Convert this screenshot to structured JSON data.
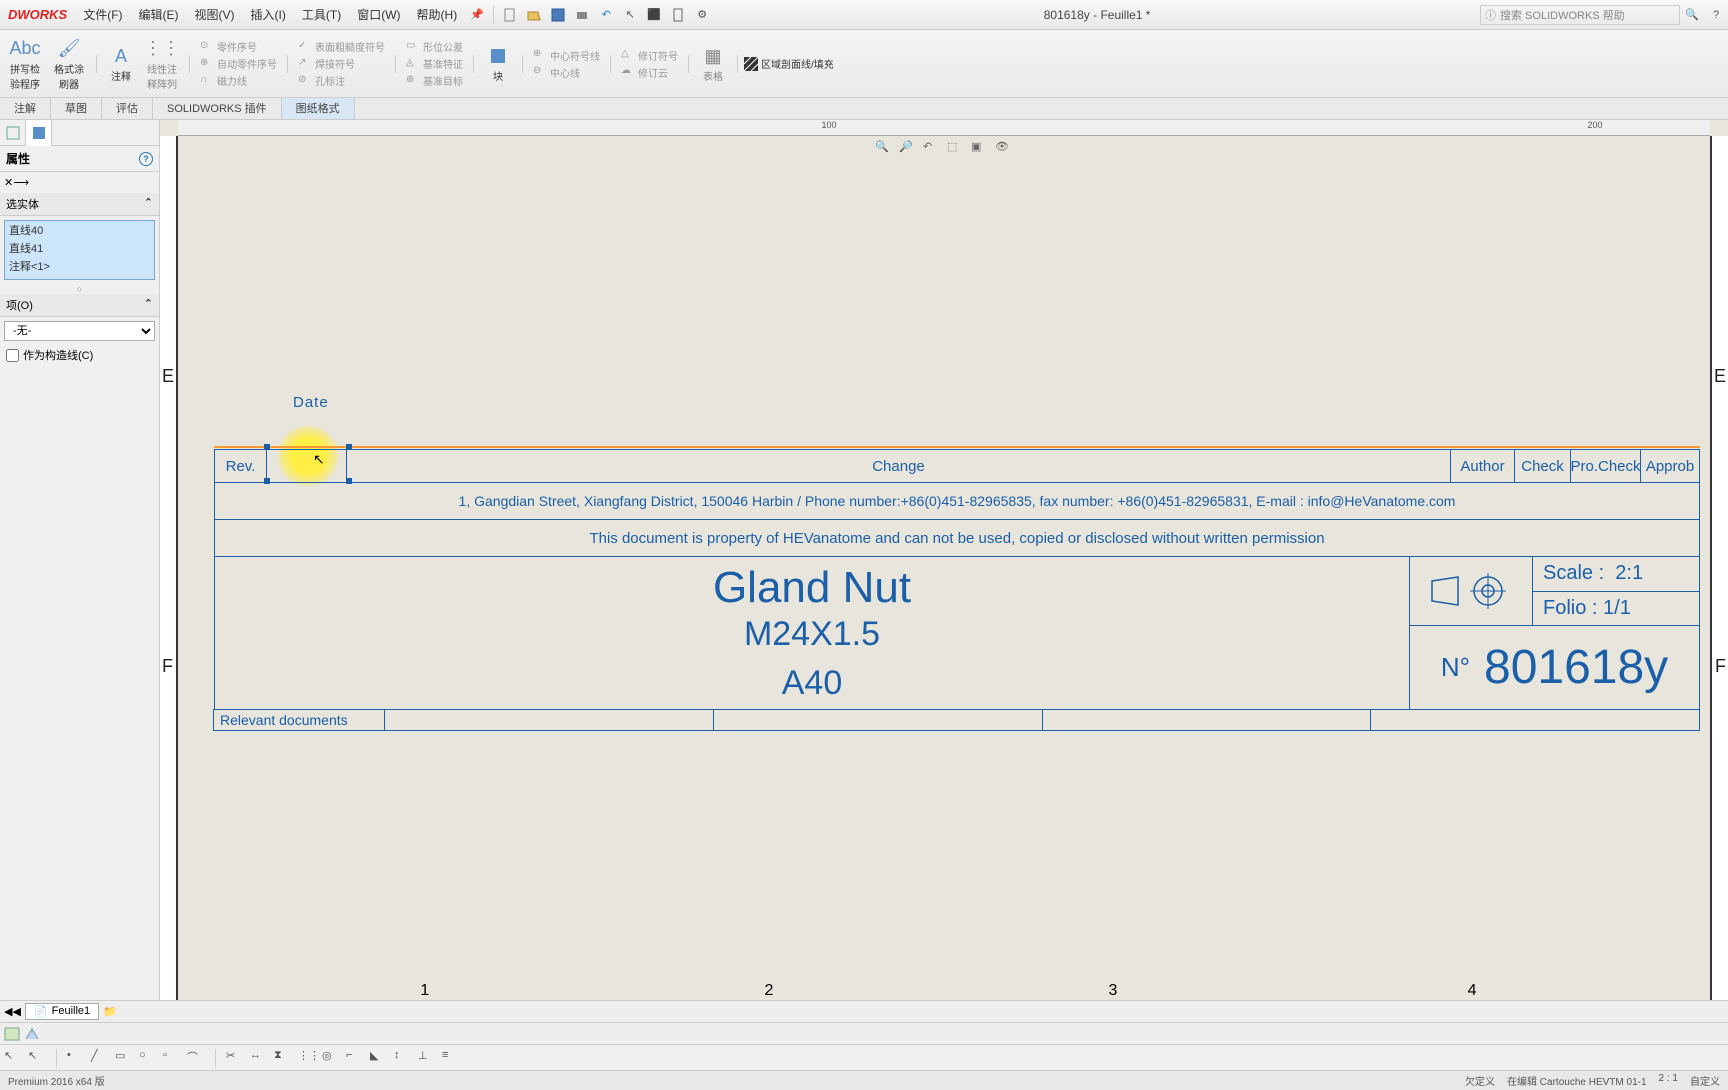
{
  "app": {
    "logo": "DWORKS",
    "doc": "801618y - Feuille1 *",
    "search_ph": "搜索 SOLIDWORKS 帮助"
  },
  "menu": [
    "文件(F)",
    "编辑(E)",
    "视图(V)",
    "插入(I)",
    "工具(T)",
    "窗口(W)",
    "帮助(H)"
  ],
  "ribbon": {
    "btns": [
      {
        "l1": "拼写检",
        "l2": "验程序"
      },
      {
        "l1": "格式涂",
        "l2": "刷器"
      },
      {
        "l1": "注释",
        "l2": ""
      },
      {
        "l1": "线性注",
        "l2": "释阵列"
      }
    ],
    "col1": [
      "零件序号",
      "自动零件序号",
      "磁力线"
    ],
    "col2": [
      "表面粗糙度符号",
      "焊接符号",
      "孔标注"
    ],
    "col3": [
      "形位公差",
      "基准特征",
      "基准目标"
    ],
    "blk": "块",
    "col4": [
      "中心符号线",
      "中心线",
      ""
    ],
    "col5": [
      "修订符号",
      "修订云",
      ""
    ],
    "tbl": "表格",
    "hatch": "区域剖面线/填充"
  },
  "tabs": [
    "注解",
    "草图",
    "评估",
    "SOLIDWORKS 插件",
    "图纸格式"
  ],
  "ruler_h": [
    "100",
    "200"
  ],
  "panel": {
    "title": "属性",
    "sec1": "选实体",
    "items": [
      "直线40",
      "直线41",
      "注释<1>"
    ],
    "sec2": "项(O)",
    "dd": "-无-",
    "chk": "作为构造线(C)"
  },
  "zones": {
    "e": "E",
    "f": "F"
  },
  "date_lbl": "Date",
  "tb": {
    "headers": [
      "Rev.",
      "",
      "Change",
      "Author",
      "Check",
      "Pro.Check",
      "Approb"
    ],
    "addr": "1, Gangdian Street, Xiangfang District, 150046 Harbin / Phone number:+86(0)451-82965835, fax number: +86(0)451-82965831, E-mail : info@HeVanatome.com",
    "prop": "This document is property of HEVanatome and can not be used, copied or disclosed without written permission",
    "part_name": "Gland Nut",
    "part_size": "M24X1.5",
    "part_mat": "A40",
    "scale_lbl": "Scale :",
    "scale_val": "2:1",
    "folio_lbl": "Folio :",
    "folio_val": "1/1",
    "num_lbl": "N°",
    "num_val": "801618y",
    "rel": "Relevant documents"
  },
  "bottom_marks": [
    "1",
    "2",
    "3",
    "4"
  ],
  "sheet": "Feuille1",
  "status": {
    "ver": "Premium 2016 x64 版",
    "r1": "欠定义",
    "r2": "在编辑 Cartouche HEVTM 01-1",
    "r3": "2 : 1",
    "r4": "自定义"
  }
}
